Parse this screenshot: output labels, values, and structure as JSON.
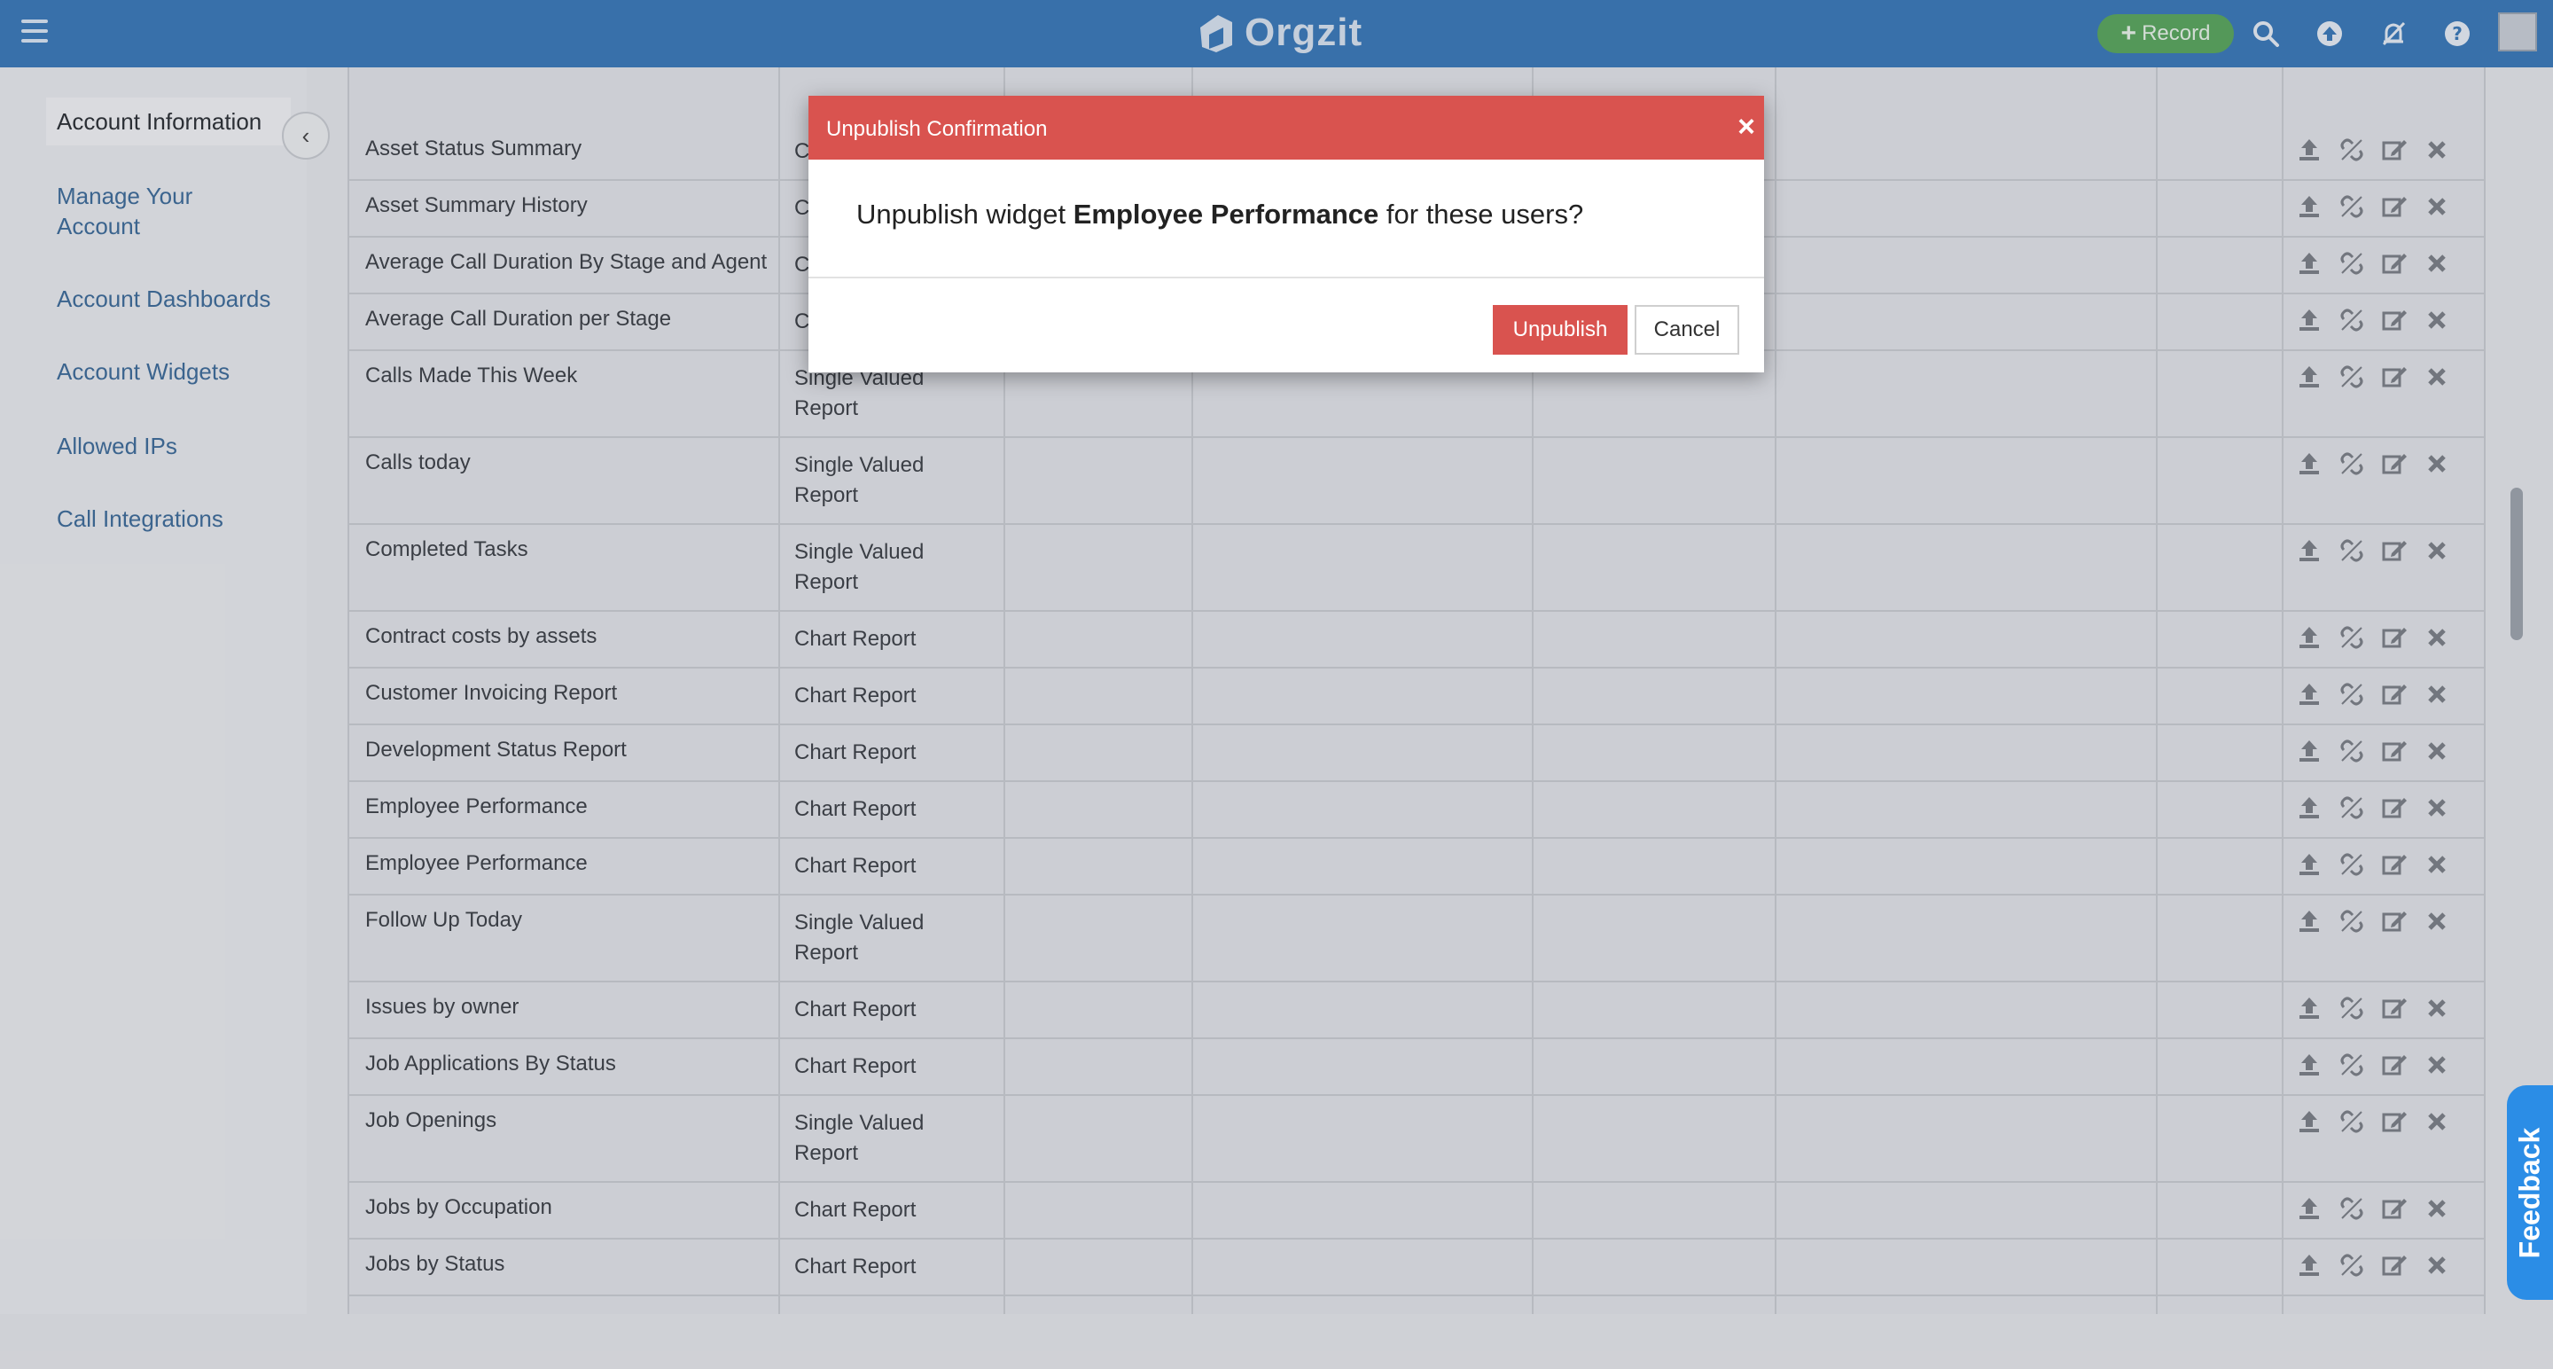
{
  "app": {
    "logo_text": "Orgzit",
    "record_label": "Record"
  },
  "topbar_icons": [
    "menu-icon",
    "search-icon",
    "upload-icon",
    "notifications-off-icon",
    "help-icon",
    "user-avatar"
  ],
  "sidebar": {
    "items": [
      {
        "label": "Account Information",
        "active": true
      },
      {
        "label": "Manage Your Account"
      },
      {
        "label": "Account Dashboards"
      },
      {
        "label": "Account Widgets"
      },
      {
        "label": "Allowed IPs"
      },
      {
        "label": "Call Integrations"
      }
    ]
  },
  "table": {
    "rows": [
      {
        "name": "Asset Status Summary",
        "type": "C"
      },
      {
        "name": "Asset Summary History",
        "type": "C"
      },
      {
        "name": "Average Call Duration By Stage and Agent",
        "type": "C"
      },
      {
        "name": "Average Call Duration per Stage",
        "type": "C"
      },
      {
        "name": "Calls Made This Week",
        "type": "Single Valued Report"
      },
      {
        "name": "Calls today",
        "type": "Single Valued Report"
      },
      {
        "name": "Completed Tasks",
        "type": "Single Valued Report"
      },
      {
        "name": "Contract costs by assets",
        "type": "Chart Report"
      },
      {
        "name": "Customer Invoicing Report",
        "type": "Chart Report"
      },
      {
        "name": "Development Status Report",
        "type": "Chart Report"
      },
      {
        "name": "Employee Performance",
        "type": "Chart Report"
      },
      {
        "name": "Employee Performance",
        "type": "Chart Report"
      },
      {
        "name": "Follow Up Today",
        "type": "Single Valued Report"
      },
      {
        "name": "Issues by owner",
        "type": "Chart Report"
      },
      {
        "name": "Job Applications By Status",
        "type": "Chart Report"
      },
      {
        "name": "Job Openings",
        "type": "Single Valued Report"
      },
      {
        "name": "Jobs by Occupation",
        "type": "Chart Report"
      },
      {
        "name": "Jobs by Status",
        "type": "Chart Report"
      }
    ],
    "row_action_icons": [
      "publish-icon",
      "unlink-icon",
      "edit-icon",
      "delete-icon"
    ]
  },
  "modal": {
    "title": "Unpublish Confirmation",
    "message_prefix": "Unpublish widget ",
    "widget_name": "Employee Performance",
    "message_suffix": " for these users?",
    "confirm_label": "Unpublish",
    "cancel_label": "Cancel"
  },
  "feedback_label": "Feedback",
  "colors": {
    "topbar": "#3878b8",
    "record_button": "#58a65c",
    "modal_header": "#d9534f",
    "link": "#3c6a98",
    "feedback_tab": "#2b8de6"
  }
}
